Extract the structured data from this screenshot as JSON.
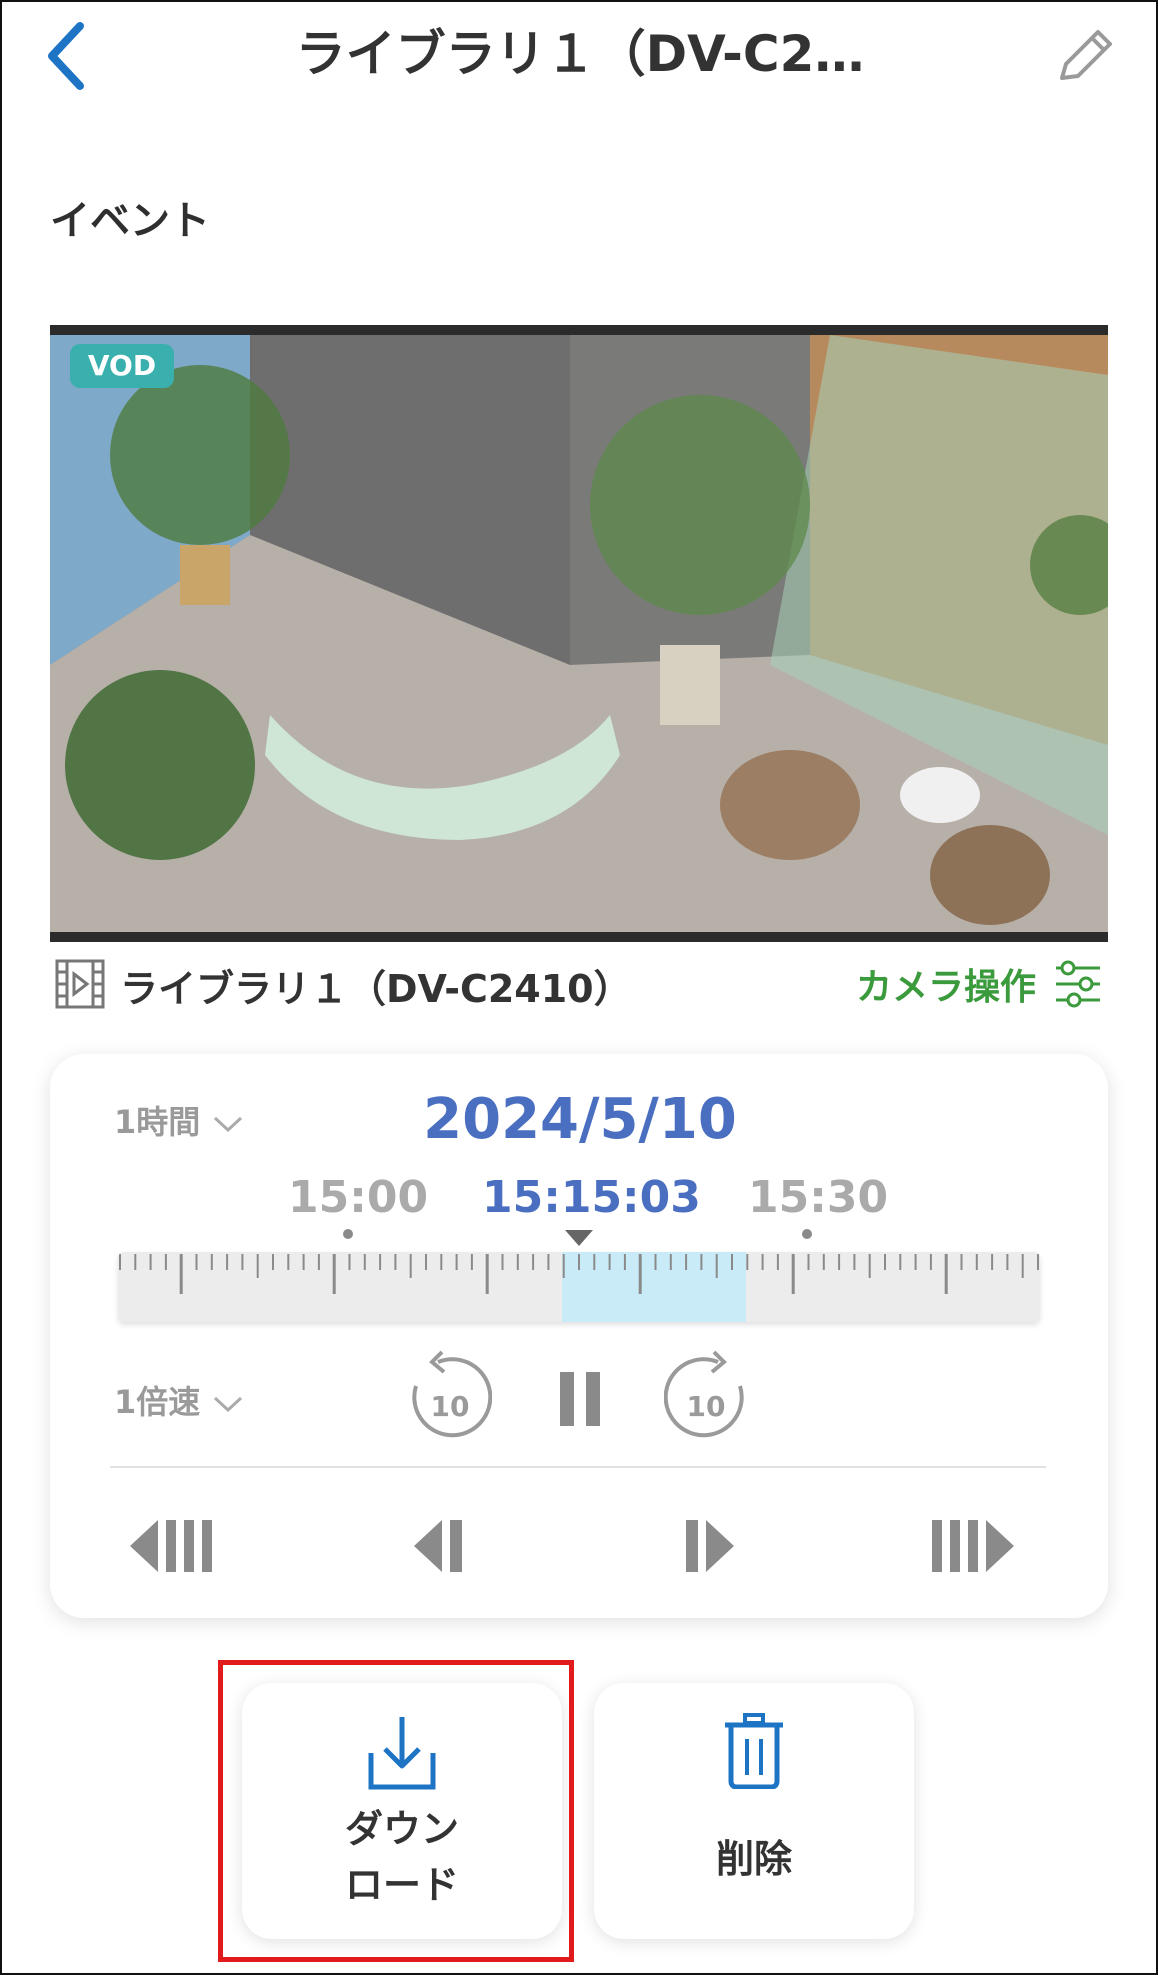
{
  "header": {
    "title": "ライブラリ１（DV-C2…",
    "back_icon": "chevron-left-icon",
    "edit_icon": "pencil-icon"
  },
  "section": {
    "label": "イベント"
  },
  "video": {
    "badge": "VOD",
    "accent": "#3ab0ae"
  },
  "camera": {
    "name": "ライブラリ１（DV-C2410）",
    "operate_label": "カメラ操作",
    "operate_color": "#3a9a3c"
  },
  "player": {
    "range": "1時間",
    "date": "2024/5/10",
    "current_time": "15:15:03",
    "tick_left": "15:00",
    "tick_right": "15:30",
    "speed": "1倍速",
    "rewind_seconds": "10",
    "forward_seconds": "10",
    "accent": "#4a6fc1"
  },
  "actions": {
    "download": [
      "ダウン",
      "ロード"
    ],
    "delete": "削除",
    "icon_color": "#1e74c4"
  }
}
